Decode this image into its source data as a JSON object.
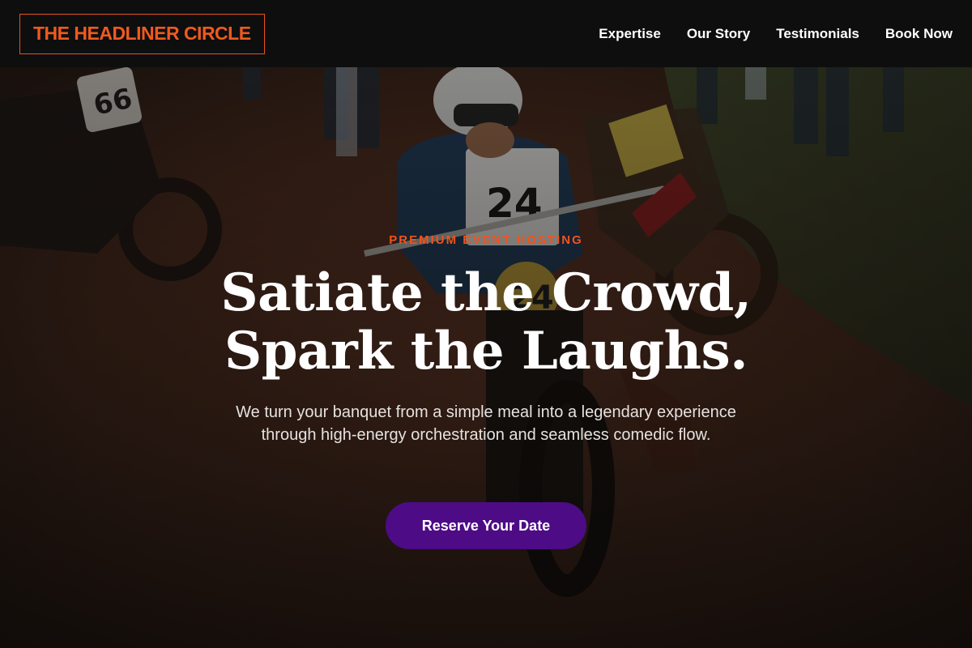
{
  "header": {
    "logo_text": "THE HEADLINER CIRCLE",
    "nav": [
      {
        "label": "Expertise"
      },
      {
        "label": "Our Story"
      },
      {
        "label": "Testimonials"
      },
      {
        "label": "Book Now"
      }
    ]
  },
  "hero": {
    "eyebrow": "PREMIUM EVENT HOSTING",
    "headline_line1": "Satiate the Crowd,",
    "headline_line2": "Spark the Laughs.",
    "subtext": "We turn your banquet from a simple meal into a legendary experience through high-energy orchestration and seamless comedic flow.",
    "cta_label": "Reserve Your Date",
    "background_image": "motorcycle-racers-dirt-track-photo"
  },
  "colors": {
    "accent_orange": "#ee5a1f",
    "cta_purple": "#4d0b85",
    "header_bg": "#0e0e0e"
  }
}
